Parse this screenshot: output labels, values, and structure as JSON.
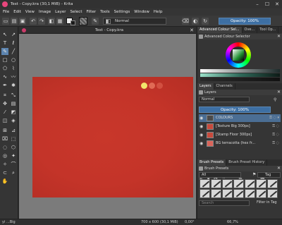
{
  "window": {
    "title": "Test - Copy.kra (30,1 MiB) - Krita",
    "minimize": "–",
    "maximize": "☐",
    "close": "✕"
  },
  "menu": [
    "File",
    "Edit",
    "View",
    "Image",
    "Layer",
    "Select",
    "Filter",
    "Tools",
    "Settings",
    "Window",
    "Help"
  ],
  "toolbar": {
    "blend_mode": "Normal",
    "opacity": "Opacity: 100%"
  },
  "document": {
    "tab_title": "Test - Copy.kra"
  },
  "dock": {
    "top_tabs": [
      "Advanced Colour Sel...",
      "Ove...",
      "Tool Op..."
    ],
    "color_selector_title": "Advanced Colour Selector",
    "layer_tabs": [
      "Layers",
      "Channels"
    ],
    "layers_title": "Layers",
    "layer_blend_mode": "Normal",
    "layer_opacity": "Opacity: 100%",
    "layers": [
      {
        "name": "COLOURS",
        "selected": true,
        "thumb": "#4a4a4a"
      },
      {
        "name": "[Texture Big 300ps]",
        "selected": false,
        "thumb": "#c84a3c"
      },
      {
        "name": "[Stamp Floor 300ps]",
        "selected": false,
        "thumb": "#c84a3c"
      },
      {
        "name": "BG terracotta (hex fr...",
        "selected": false,
        "thumb": "#d9645a"
      }
    ],
    "brush_tabs": [
      "Brush Presets",
      "Brush Preset History"
    ],
    "brush_title": "Brush Presets",
    "brush_filter": "All",
    "brush_tag": "Tag",
    "search_placeholder": "Search",
    "filter_in_tag": "Filter in Tag"
  },
  "status": {
    "left": "yi ...Big",
    "brush": "RGB/Alpha (8-bit integer/channel) sRGB-elle-V2-srgbtrc.icc",
    "size": "700 x 600 (30,1 MiB)",
    "angle": "0,00°",
    "zoom": "66,7%"
  },
  "colors": {
    "painting": "#c43429",
    "accent": "#3d6fa3"
  }
}
